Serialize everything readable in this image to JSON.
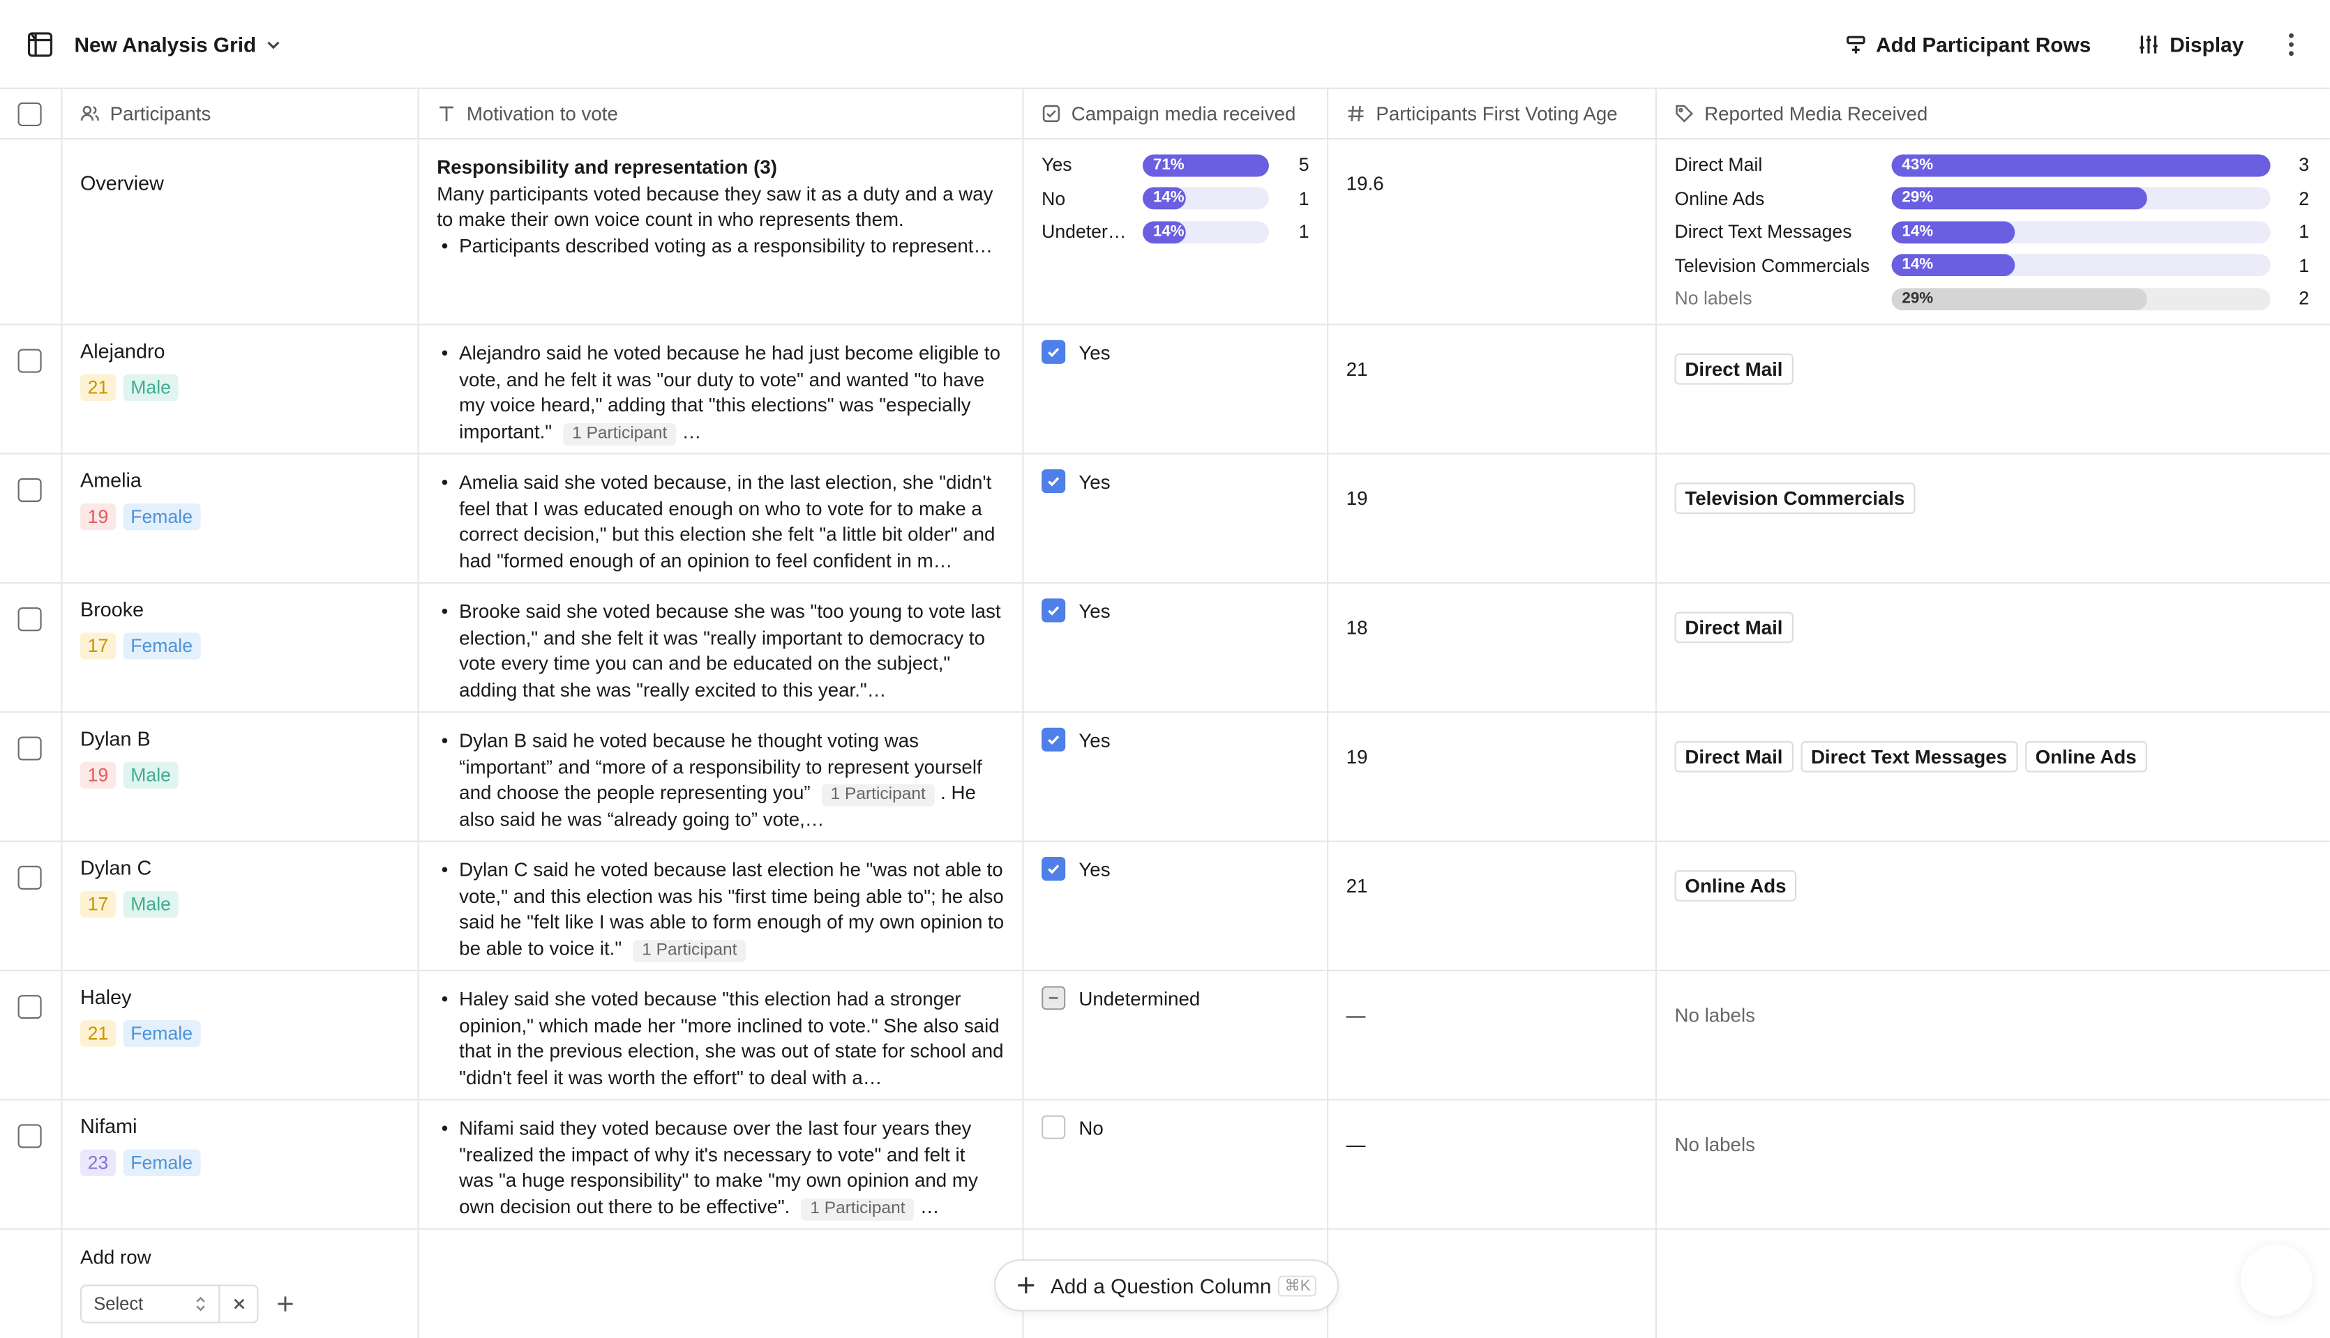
{
  "topbar": {
    "title": "New Analysis Grid",
    "add_rows_label": "Add Participant Rows",
    "display_label": "Display"
  },
  "columns": [
    "Participants",
    "Motivation to vote",
    "Campaign media received",
    "Participants First Voting Age",
    "Reported Media Received"
  ],
  "overview": {
    "label": "Overview",
    "theme_title": "Responsibility and representation (3)",
    "theme_desc": "Many participants voted because they saw it as a duty and a way to make their own voice count in who represents them.",
    "theme_bullet": "Participants described voting as a responsibility to represent…",
    "campaign_stats": [
      {
        "label": "Yes",
        "pct_label": "71%",
        "value": 0.71,
        "count": "5"
      },
      {
        "label": "No",
        "pct_label": "14%",
        "value": 0.14,
        "count": "1"
      },
      {
        "label": "Undeter…",
        "pct_label": "14%",
        "value": 0.14,
        "count": "1"
      }
    ],
    "age_avg": "19.6",
    "media_stats": [
      {
        "label": "Direct Mail",
        "pct_label": "43%",
        "value": 0.43,
        "count": "3"
      },
      {
        "label": "Online Ads",
        "pct_label": "29%",
        "value": 0.29,
        "count": "2"
      },
      {
        "label": "Direct Text Messages",
        "pct_label": "14%",
        "value": 0.14,
        "count": "1"
      },
      {
        "label": "Television Commercials",
        "pct_label": "14%",
        "value": 0.14,
        "count": "1"
      },
      {
        "label": "No labels",
        "pct_label": "29%",
        "value": 0.29,
        "count": "2",
        "muted": true
      }
    ]
  },
  "rows": [
    {
      "name": "Alejandro",
      "age": "21",
      "gender": "Male",
      "motivation": "Alejandro said he voted because he had just become eligible to vote, and he felt it was \"our duty to vote\" and wanted \"to have my voice heard,\" adding that \"this elections\" was \"especially important.\"",
      "cite": "1 Participant",
      "tail": "…",
      "campaign": "Yes",
      "first_age": "21",
      "media": [
        "Direct Mail"
      ]
    },
    {
      "name": "Amelia",
      "age": "19",
      "gender": "Female",
      "motivation": "Amelia said she voted because, in the last election, she \"didn't feel that I was educated enough on who to vote for to make a correct decision,\" but this election she felt \"a little bit older\" and had \"formed enough of an opinion to feel confident in m…",
      "cite": "",
      "tail": "",
      "campaign": "Yes",
      "first_age": "19",
      "media": [
        "Television Commercials"
      ]
    },
    {
      "name": "Brooke",
      "age": "17",
      "gender": "Female",
      "motivation": "Brooke said she voted because she was \"too young to vote last election,\" and she felt it was \"really important to democracy to vote every time you can and be educated on the subject,\" adding that she was \"really excited to this year.\"…",
      "cite": "",
      "tail": "",
      "campaign": "Yes",
      "first_age": "18",
      "media": [
        "Direct Mail"
      ]
    },
    {
      "name": "Dylan B",
      "age": "19",
      "gender": "Male",
      "motivation": "Dylan B said he voted because he thought voting was “important” and “more of a responsibility to represent yourself and choose the people representing you”",
      "cite": "1 Participant",
      "tail": ". He also said he was “already going to” vote,…",
      "campaign": "Yes",
      "first_age": "19",
      "media": [
        "Direct Mail",
        "Direct Text Messages",
        "Online Ads"
      ]
    },
    {
      "name": "Dylan C",
      "age": "17",
      "gender": "Male",
      "motivation": "Dylan C said he voted because last election he \"was not able to vote,\" and this election was his \"first time being able to\"; he also said he \"felt like I was able to form enough of my own opinion to be able to voice it.\"",
      "cite": "1 Participant",
      "tail": "",
      "campaign": "Yes",
      "first_age": "21",
      "media": [
        "Online Ads"
      ]
    },
    {
      "name": "Haley",
      "age": "21",
      "gender": "Female",
      "motivation": "Haley said she voted because \"this election had a stronger opinion,\" which made her \"more inclined to vote.\" She also said that in the previous election, she was out of state for school and \"didn't feel it was worth the effort\" to deal with a…",
      "cite": "",
      "tail": "",
      "campaign": "Undetermined",
      "first_age": "—",
      "media": [],
      "no_labels": "No labels"
    },
    {
      "name": "Nifami",
      "age": "23",
      "gender": "Female",
      "motivation": "Nifami said they voted because over the last four years they \"realized the impact of why it's necessary to vote\" and felt it was \"a huge responsibility\" to make \"my own opinion and my own decision out there to be effective\".",
      "cite": "1 Participant",
      "tail": "…",
      "campaign": "No",
      "first_age": "—",
      "media": [],
      "no_labels": "No labels"
    }
  ],
  "add_row": {
    "label": "Add row",
    "select_placeholder": "Select"
  },
  "add_question": {
    "label": "Add a Question Column",
    "shortcut": "⌘K"
  },
  "colors": {
    "accent": "#6a5fe0",
    "checkbox": "#4f7fe8",
    "border": "#e6e6e6"
  }
}
